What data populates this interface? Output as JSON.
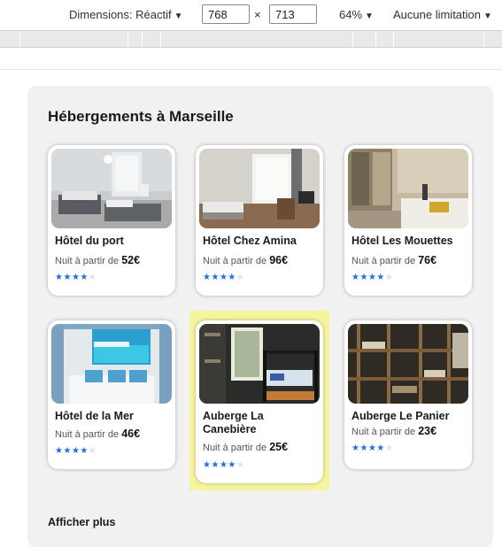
{
  "toolbar": {
    "dimensions_label": "Dimensions: Réactif",
    "width_value": "768",
    "height_value": "713",
    "times": "×",
    "zoom": "64%",
    "throttle": "Aucune limitation",
    "caret": "▼"
  },
  "section": {
    "title": "Hébergements à Marseille",
    "show_more": "Afficher plus"
  },
  "price_prefix": "Nuit à partir de",
  "currency": "€",
  "star_color": "#1f6fe0",
  "highlight_color": "#f7f49f",
  "hotels": [
    {
      "name": "Hôtel du port",
      "price": "52",
      "rating": 4,
      "max": 5
    },
    {
      "name": "Hôtel Chez Amina",
      "price": "96",
      "rating": 4,
      "max": 5
    },
    {
      "name": "Hôtel Les Mouettes",
      "price": "76",
      "rating": 4,
      "max": 5
    },
    {
      "name": "Hôtel de la Mer",
      "price": "46",
      "rating": 4,
      "max": 5
    },
    {
      "name": "Auberge La Canebière",
      "price": "25",
      "rating": 4,
      "max": 5
    },
    {
      "name": "Auberge Le Panier",
      "price": "23",
      "rating": 4,
      "max": 5
    }
  ]
}
